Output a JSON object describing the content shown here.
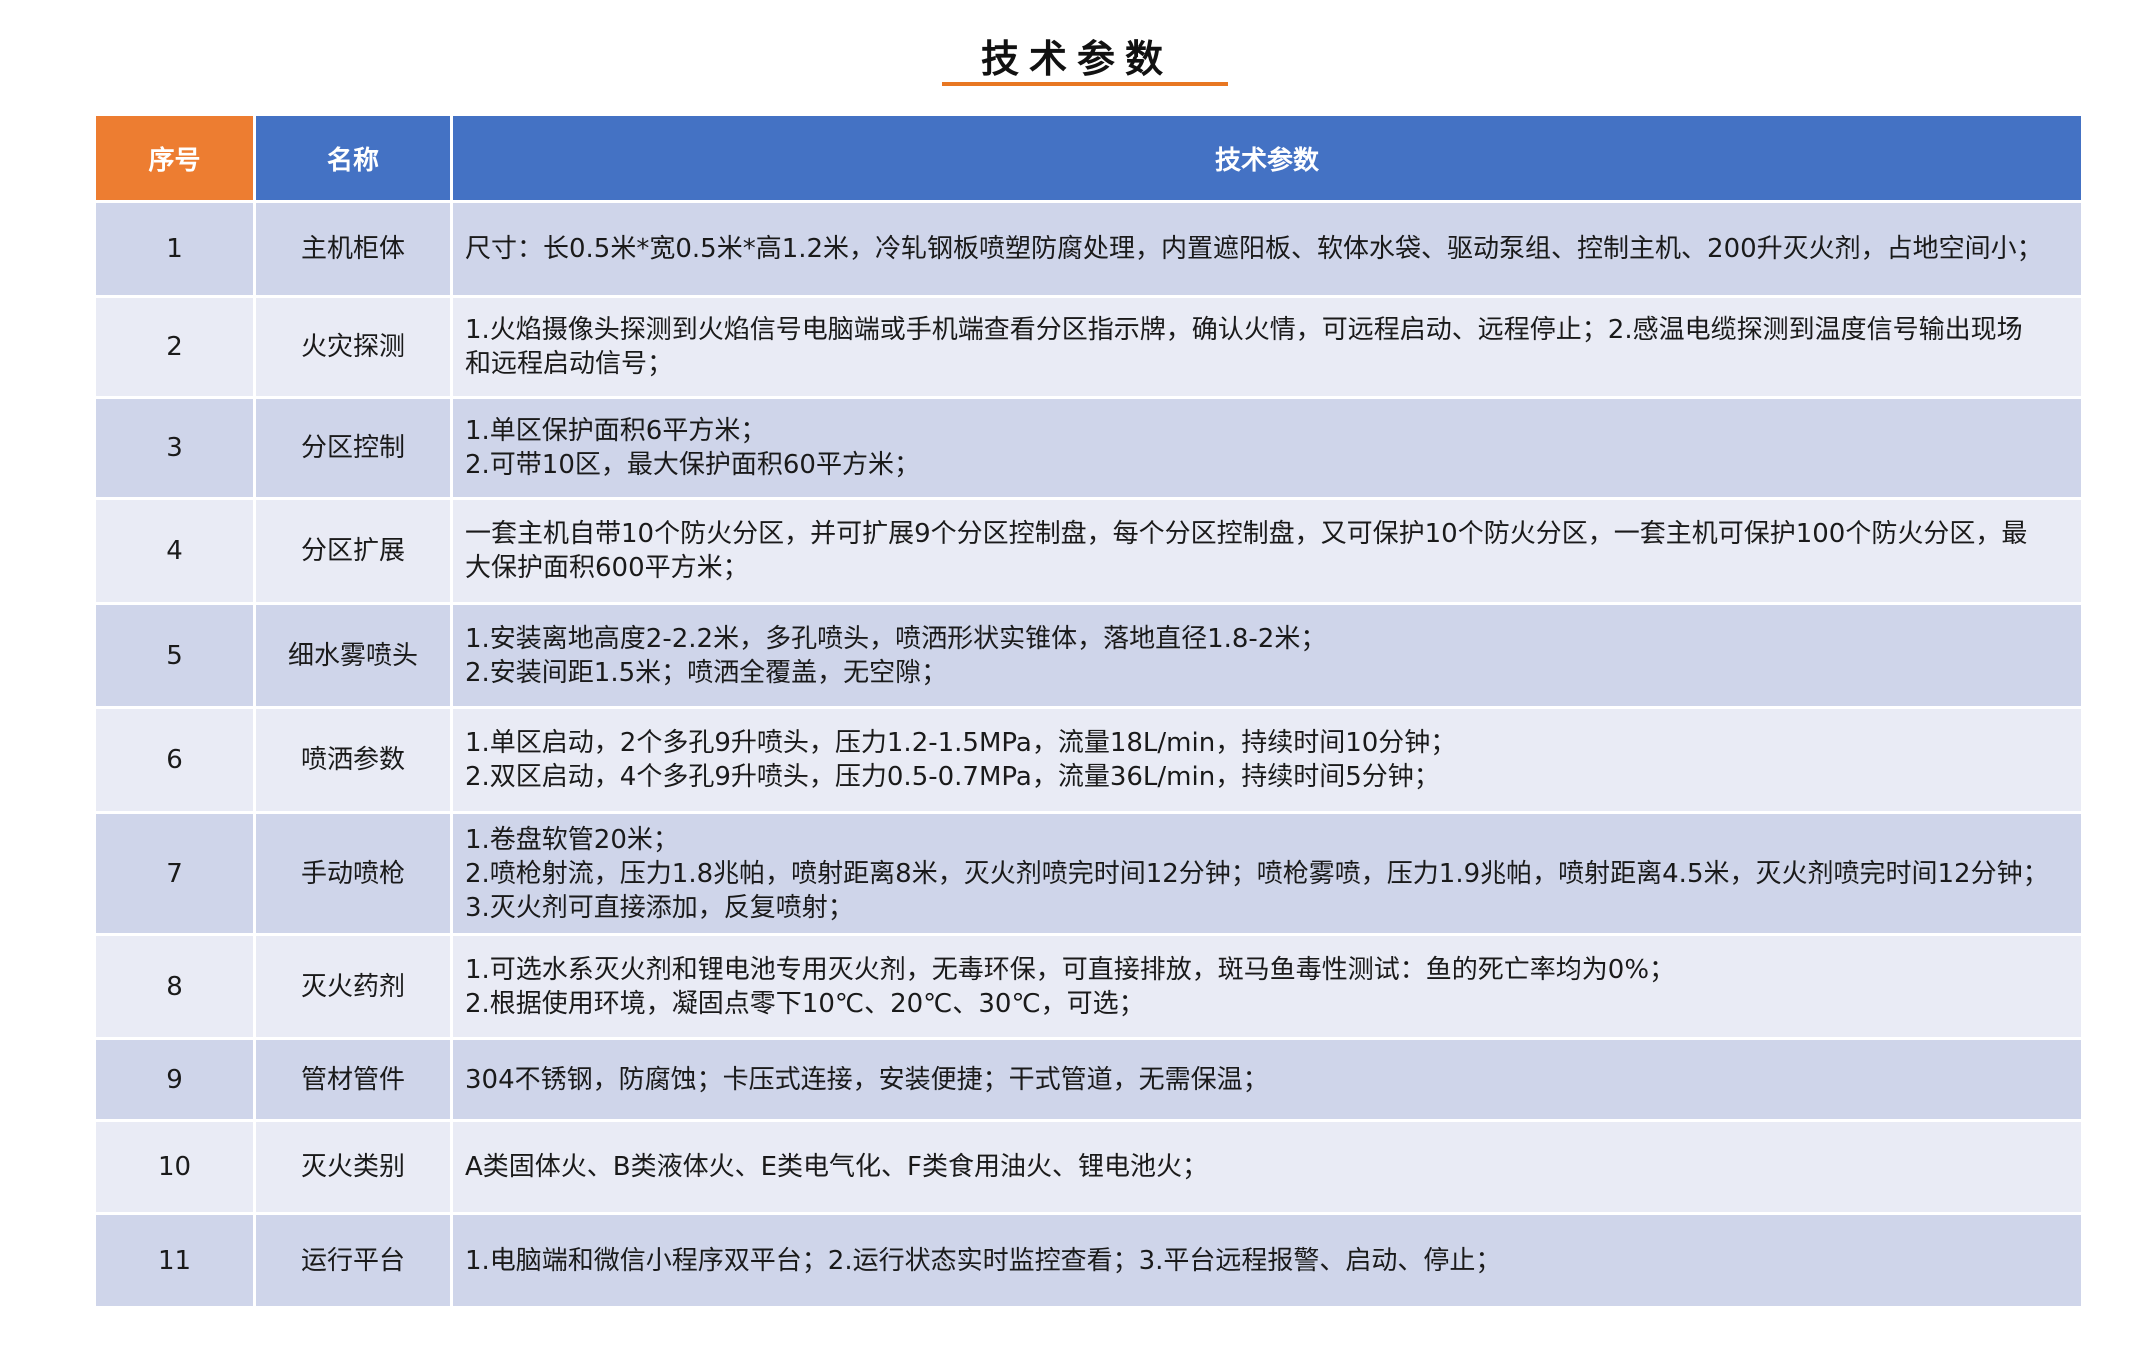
{
  "title": "技术参数",
  "colors": {
    "header_blue": "#4472c4",
    "header_orange": "#ed7d31",
    "row_dark": "#cfd5ea",
    "row_light": "#e9ebf5",
    "underline": "#e87722"
  },
  "table": {
    "headers": [
      "序号",
      "名称",
      "技术参数"
    ],
    "rows": [
      {
        "no": "1",
        "name": "主机柜体",
        "lines": [
          "尺寸：长0.5米*宽0.5米*高1.2米，冷轧钢板喷塑防腐处理，内置遮阳板、软体水袋、驱动泵组、控制主机、200升灭火剂，占地空间小；"
        ]
      },
      {
        "no": "2",
        "name": "火灾探测",
        "lines": [
          "1.火焰摄像头探测到火焰信号电脑端或手机端查看分区指示牌，确认火情，可远程启动、远程停止；2.感温电缆探测到温度信号输出现场",
          "和远程启动信号；"
        ]
      },
      {
        "no": "3",
        "name": "分区控制",
        "lines": [
          "1.单区保护面积6平方米；",
          "2.可带10区，最大保护面积60平方米；"
        ]
      },
      {
        "no": "4",
        "name": "分区扩展",
        "lines": [
          "一套主机自带10个防火分区，并可扩展9个分区控制盘，每个分区控制盘，又可保护10个防火分区，一套主机可保护100个防火分区，最",
          "大保护面积600平方米；"
        ]
      },
      {
        "no": "5",
        "name": "细水雾喷头",
        "lines": [
          "1.安装离地高度2-2.2米，多孔喷头，喷洒形状实锥体，落地直径1.8-2米；",
          "2.安装间距1.5米；喷洒全覆盖，无空隙；"
        ]
      },
      {
        "no": "6",
        "name": "喷洒参数",
        "lines": [
          "1.单区启动，2个多孔9升喷头，压力1.2-1.5MPa，流量18L/min，持续时间10分钟；",
          "2.双区启动，4个多孔9升喷头，压力0.5-0.7MPa，流量36L/min，持续时间5分钟；"
        ]
      },
      {
        "no": "7",
        "name": "手动喷枪",
        "lines": [
          "1.卷盘软管20米；",
          "2.喷枪射流，压力1.8兆帕，喷射距离8米，灭火剂喷完时间12分钟；喷枪雾喷，压力1.9兆帕，喷射距离4.5米，灭火剂喷完时间12分钟；",
          "3.灭火剂可直接添加，反复喷射；"
        ]
      },
      {
        "no": "8",
        "name": "灭火药剂",
        "lines": [
          "1.可选水系灭火剂和锂电池专用灭火剂，无毒环保，可直接排放，斑马鱼毒性测试：鱼的死亡率均为0%；",
          "2.根据使用环境，凝固点零下10℃、20℃、30℃，可选；"
        ]
      },
      {
        "no": "9",
        "name": "管材管件",
        "lines": [
          "304不锈钢，防腐蚀；卡压式连接，安装便捷；干式管道，无需保温；"
        ]
      },
      {
        "no": "10",
        "name": "灭火类别",
        "lines": [
          "A类固体火、B类液体火、E类电气化、F类食用油火、锂电池火；"
        ]
      },
      {
        "no": "11",
        "name": "运行平台",
        "lines": [
          "1.电脑端和微信小程序双平台；2.运行状态实时监控查看；3.平台远程报警、启动、停止；"
        ]
      }
    ]
  }
}
